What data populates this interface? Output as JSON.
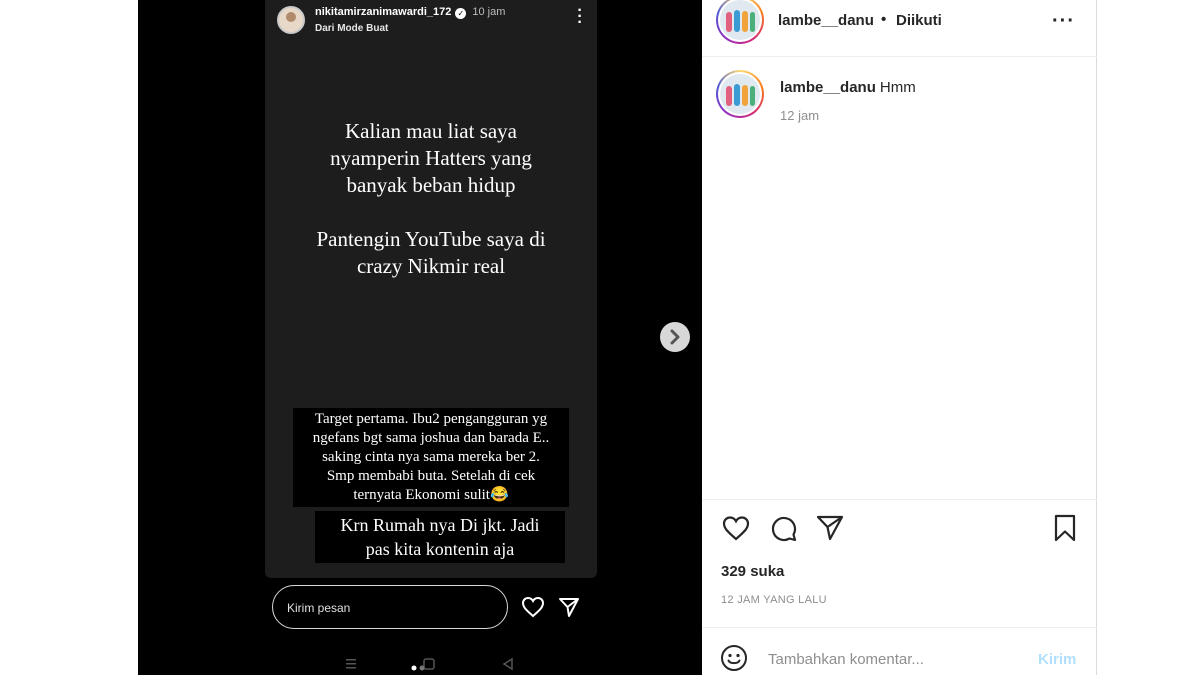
{
  "story": {
    "username": "nikitamirzanimawardi_172",
    "time": "10 jam",
    "subtitle": "Dari Mode Buat",
    "main_text_1": "Kalian mau liat saya\nnyamperin Hatters yang\nbanyak beban hidup",
    "main_text_2": "Pantengin YouTube saya di\ncrazy Nikmir real",
    "caption_1": "Target pertama. Ibu2 pengangguran yg\nngefans bgt sama joshua dan barada E..\nsaking cinta nya sama mereka ber 2.\nSmp membabi buta. Setelah di cek\nternyata Ekonomi sulit😂",
    "caption_2": "Krn Rumah nya Di jkt. Jadi\npas kita kontenin aja",
    "message_placeholder": "Kirim pesan"
  },
  "post": {
    "username": "lambe__danu",
    "follow_status": "Diikuti",
    "comment_username": "lambe__danu",
    "comment_text": "Hmm",
    "comment_time": "12 jam",
    "likes": "329 suka",
    "posted_ago": "12 JAM YANG LALU",
    "add_comment_placeholder": "Tambahkan komentar...",
    "post_button": "Kirim"
  },
  "icons": {
    "story_menu": "more-vertical-icon",
    "story_like": "heart-icon",
    "story_send": "send-icon",
    "next": "chevron-right-icon",
    "header_more": "more-horizontal-icon",
    "like": "heart-icon",
    "comment": "comment-icon",
    "share": "send-icon",
    "save": "bookmark-icon",
    "emoji": "emoji-icon"
  },
  "colors": {
    "accent_link": "#0095f6",
    "post_button_disabled": "#b2dffc",
    "text_primary": "#262626",
    "text_secondary": "#8e8e8e"
  }
}
